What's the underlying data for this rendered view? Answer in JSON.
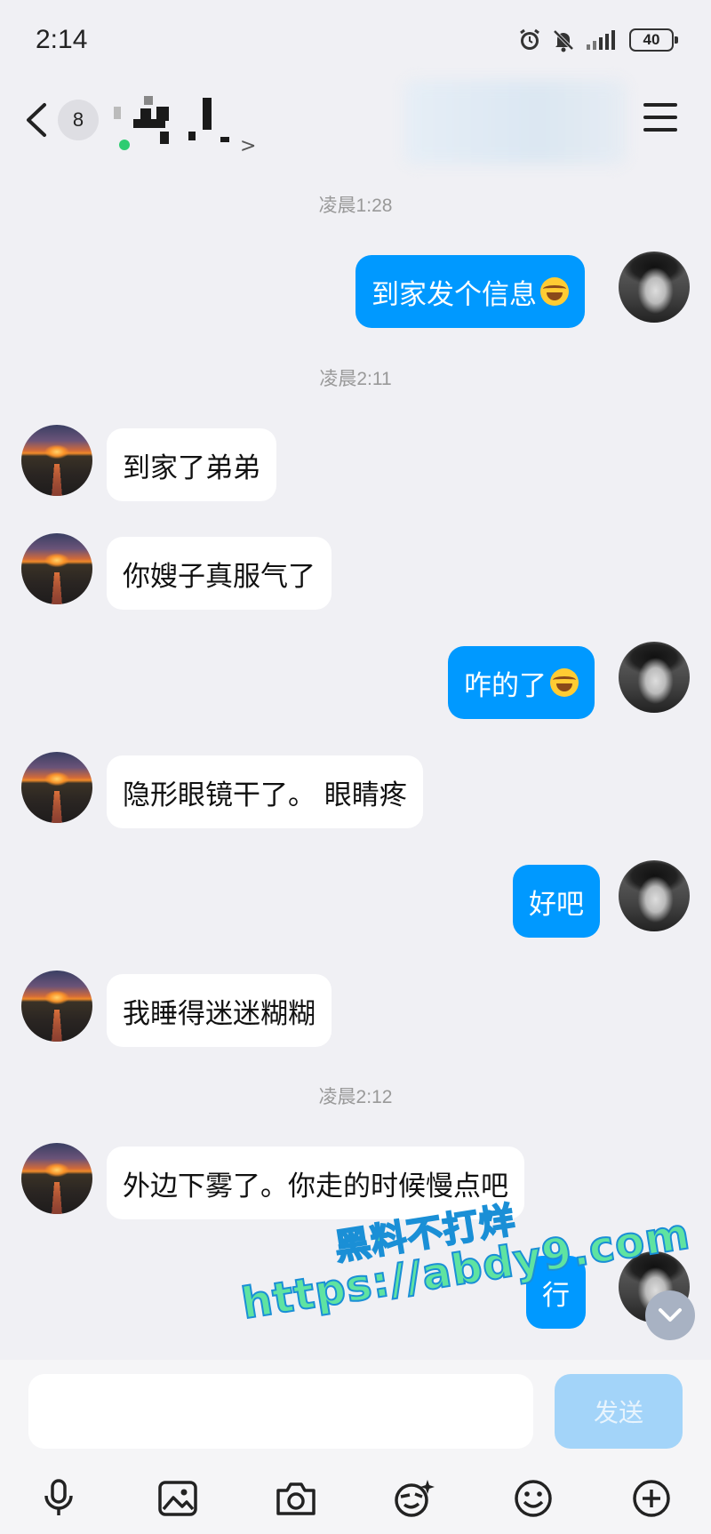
{
  "status_bar": {
    "time": "2:14",
    "battery": "40",
    "icons": [
      "alarm-icon",
      "mute-icon",
      "signal-icon",
      "battery-icon"
    ]
  },
  "header": {
    "unread_count": "8",
    "contact_name": "",
    "menu_icon": "menu-icon"
  },
  "messages": [
    {
      "type": "timestamp",
      "text": "凌晨1:28"
    },
    {
      "type": "out",
      "text": "到家发个信息",
      "emoji": "laughing-tears"
    },
    {
      "type": "timestamp",
      "text": "凌晨2:11"
    },
    {
      "type": "in",
      "text": "到家了弟弟"
    },
    {
      "type": "in",
      "text": "你嫂子真服气了"
    },
    {
      "type": "out",
      "text": "咋的了",
      "emoji": "laughing-tears"
    },
    {
      "type": "in",
      "text": "隐形眼镜干了。 眼睛疼"
    },
    {
      "type": "out",
      "text": "好吧"
    },
    {
      "type": "in",
      "text": "我睡得迷迷糊糊"
    },
    {
      "type": "timestamp",
      "text": "凌晨2:12"
    },
    {
      "type": "in",
      "text": "外边下雾了。你走的时候慢点吧"
    },
    {
      "type": "out",
      "text": "行"
    }
  ],
  "watermark": {
    "line1": "黑料不打烊",
    "line2": "https://abdy9.com"
  },
  "input": {
    "placeholder": "",
    "send_label": "发送"
  },
  "toolbar": [
    "microphone-icon",
    "image-icon",
    "camera-icon",
    "sticker-icon",
    "emoji-icon",
    "plus-icon"
  ],
  "colors": {
    "background": "#f0f0f4",
    "outgoing_bubble": "#0099ff",
    "incoming_bubble": "#ffffff",
    "send_button_disabled": "#a3d4f9",
    "timestamp_text": "#999999"
  }
}
